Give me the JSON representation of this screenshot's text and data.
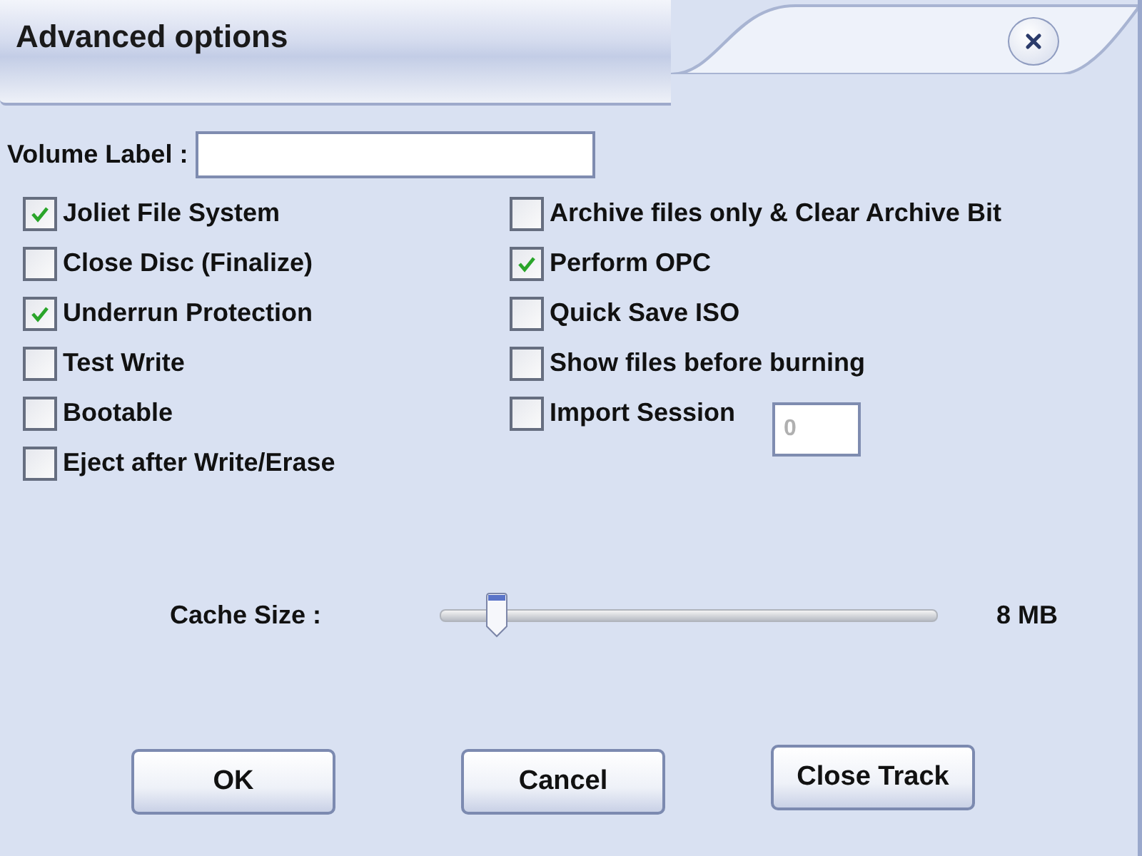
{
  "window": {
    "title": "Advanced options"
  },
  "volume_label": {
    "label": "Volume Label :"
  },
  "options_left": [
    {
      "label": "Joliet File System",
      "checked": true
    },
    {
      "label": "Close Disc (Finalize)",
      "checked": false
    },
    {
      "label": "Underrun Protection",
      "checked": true
    },
    {
      "label": "Test Write",
      "checked": false
    },
    {
      "label": "Bootable",
      "checked": false
    },
    {
      "label": "Eject after Write/Erase",
      "checked": false
    }
  ],
  "options_right": [
    {
      "label": "Archive files only & Clear Archive Bit",
      "checked": false
    },
    {
      "label": "Perform OPC",
      "checked": true
    },
    {
      "label": "Quick Save ISO",
      "checked": false
    },
    {
      "label": "Show files before burning",
      "checked": false
    },
    {
      "label": "Import Session",
      "checked": false,
      "field": {
        "value": "0",
        "disabled": true
      }
    }
  ],
  "cache_size": {
    "label": "Cache Size :",
    "level": 0.115,
    "reading": "8 MB"
  },
  "buttons": [
    "OK",
    "Cancel",
    "Close Track"
  ]
}
